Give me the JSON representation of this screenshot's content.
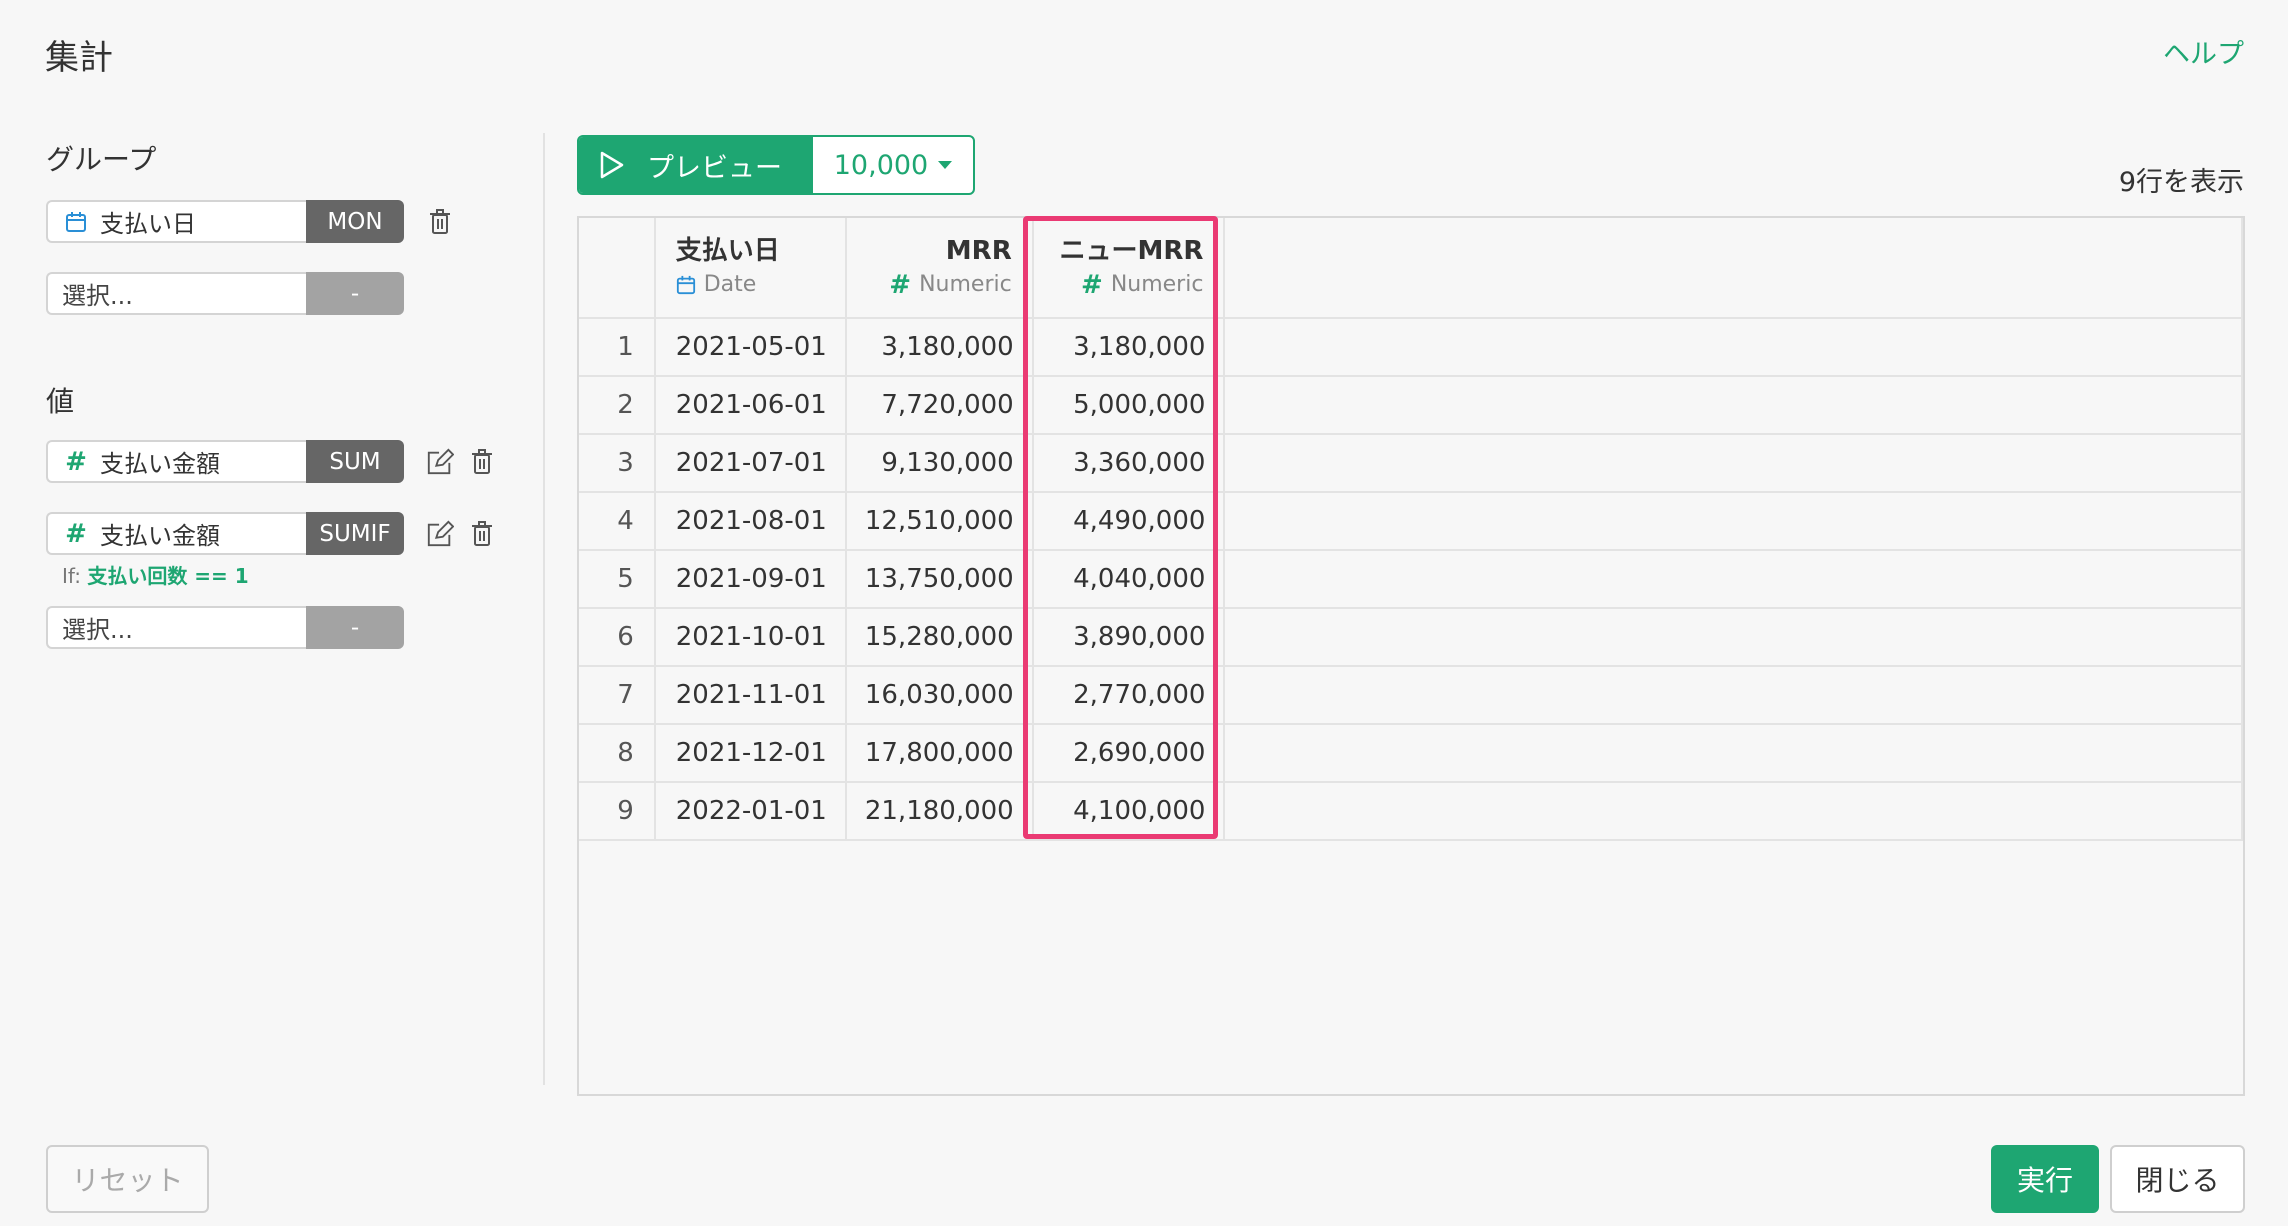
{
  "header": {
    "title": "集計",
    "help": "ヘルプ"
  },
  "left": {
    "group_label": "グループ",
    "group_fields": [
      {
        "name": "支払い日",
        "agg": "MON",
        "icon": "calendar-icon"
      }
    ],
    "group_select": {
      "placeholder": "選択...",
      "agg": "-"
    },
    "value_label": "値",
    "value_fields": [
      {
        "name": "支払い金額",
        "agg": "SUM",
        "icon": "hash-icon"
      },
      {
        "name": "支払い金額",
        "agg": "SUMIF",
        "icon": "hash-icon",
        "condition_prefix": "If:",
        "condition": "支払い回数 == 1"
      }
    ],
    "value_select": {
      "placeholder": "選択...",
      "agg": "-"
    }
  },
  "toolbar": {
    "preview_label": "プレビュー",
    "rows_limit": "10,000",
    "row_count": "9行を表示"
  },
  "table": {
    "columns": [
      {
        "name": "支払い日",
        "type": "Date",
        "type_icon": "calendar-icon"
      },
      {
        "name": "MRR",
        "type": "Numeric",
        "type_icon": "hash-icon"
      },
      {
        "name": "ニューMRR",
        "type": "Numeric",
        "type_icon": "hash-icon"
      }
    ],
    "rows": [
      [
        "1",
        "2021-05-01",
        "3,180,000",
        "3,180,000"
      ],
      [
        "2",
        "2021-06-01",
        "7,720,000",
        "5,000,000"
      ],
      [
        "3",
        "2021-07-01",
        "9,130,000",
        "3,360,000"
      ],
      [
        "4",
        "2021-08-01",
        "12,510,000",
        "4,490,000"
      ],
      [
        "5",
        "2021-09-01",
        "13,750,000",
        "4,040,000"
      ],
      [
        "6",
        "2021-10-01",
        "15,280,000",
        "3,890,000"
      ],
      [
        "7",
        "2021-11-01",
        "16,030,000",
        "2,770,000"
      ],
      [
        "8",
        "2021-12-01",
        "17,800,000",
        "2,690,000"
      ],
      [
        "9",
        "2022-01-01",
        "21,180,000",
        "4,100,000"
      ]
    ],
    "highlight_color": "#ea3a73"
  },
  "footer": {
    "reset": "リセット",
    "run": "実行",
    "close": "閉じる"
  },
  "colors": {
    "accent": "#1ea672",
    "agg_bg": "#666666",
    "highlight": "#ea3a73"
  }
}
